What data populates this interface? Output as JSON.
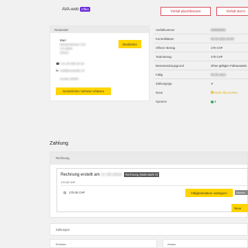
{
  "app": {
    "title": "AVA-web",
    "badge": "Offen"
  },
  "actions": {
    "close_case": "Vorfall abschliessen",
    "cancel_case": "Vorfall storni"
  },
  "reporter": {
    "header": "Reisender",
    "name": "Muri",
    "line1": "Musterstrasse 123",
    "line2": "CH-8000",
    "line3": "Zürich",
    "phone": "+41 00 000 00 00",
    "email": "mail@example.ch",
    "extra": "Kunde 00000",
    "edit_label": "Bearbeiten",
    "representative_label": "Gesetzlichen Vertreter erfassen"
  },
  "details": [
    {
      "label": "Vorfallnummer",
      "value": "000000000"
    },
    {
      "label": "Kontrolldatum",
      "value": "00.00.2023 00:00"
    },
    {
      "label": "Offener Betrag",
      "value": "170 CHF"
    },
    {
      "label": "Total Betrag",
      "value": "170 CHF"
    },
    {
      "label": "Beanstandungsgrund",
      "value": "Ohne gültigen Fahrausweis"
    },
    {
      "label": "Fällig",
      "value": "00.00.2023"
    },
    {
      "label": "Zahlungstyp",
      "value": "✔"
    },
    {
      "label": "Nova",
      "value": "Nach Abo suchen"
    },
    {
      "label": "SynServ",
      "value": "4"
    }
  ],
  "payment": {
    "section_title": "Zahlung",
    "panel_header": "Rechnung",
    "invoice_title": "Rechnung erstellt am",
    "invoice_date": "27.00.2023",
    "invoice_badge": "Rechnung (Mahnstufe 0)",
    "amount_top": "170.00 CHF",
    "amount": "170.00 CHF",
    "due_button": "Fälligkeitsdatum verlängern",
    "due_more": "Mahnen",
    "new_button": "Neue"
  },
  "payments_header": "Zahlungen",
  "bottom_left": "Einlösen",
  "bottom_right": "Anlass"
}
